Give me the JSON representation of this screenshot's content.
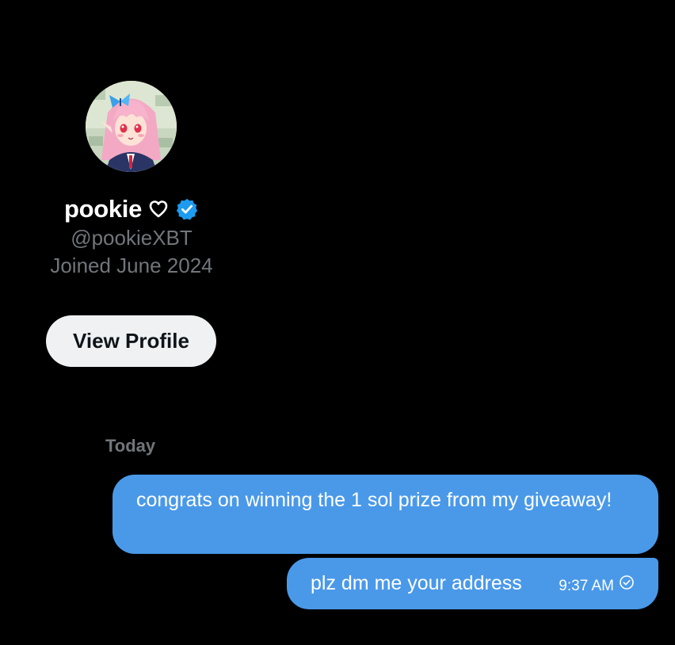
{
  "profile": {
    "avatar_alt": "avatar",
    "display_name": "pookie",
    "heart_icon": "heart-outline-icon",
    "verified_icon": "verified-badge-icon",
    "handle": "@pookieXBT",
    "joined": "Joined June 2024",
    "view_profile_label": "View Profile"
  },
  "conversation": {
    "day_label": "Today",
    "messages": [
      {
        "text": "congrats on winning the 1 sol prize from my giveaway!"
      },
      {
        "text": "plz dm me your address",
        "time": "9:37 AM",
        "status_icon": "sent-check-icon"
      }
    ]
  },
  "colors": {
    "background": "#000000",
    "bubble": "#4a99e9",
    "muted_text": "#71767b",
    "verified": "#1d9bf0",
    "button_bg": "#eff1f2"
  }
}
